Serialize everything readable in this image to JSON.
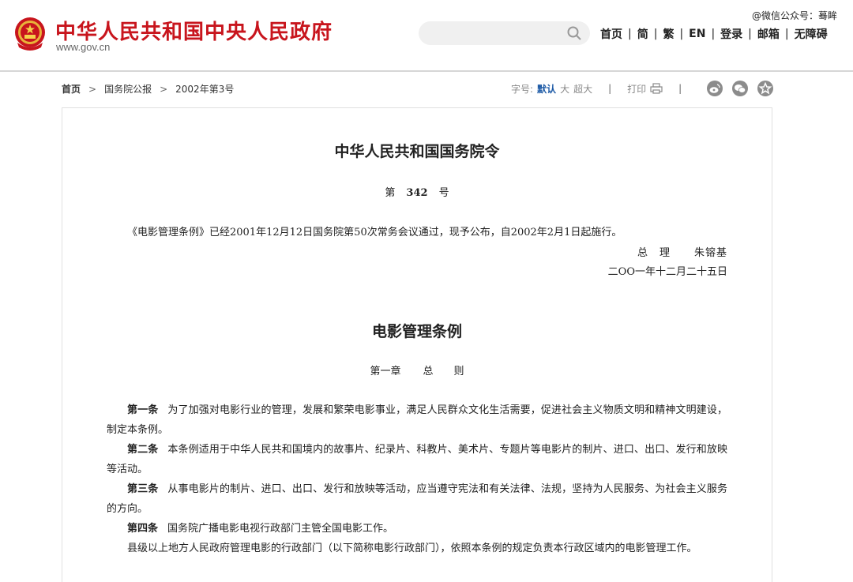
{
  "header": {
    "site_title": "中华人民共和国中央人民政府",
    "site_domain": "www.gov.cn",
    "watermark": "@微信公众号：蓦眸",
    "nav": [
      "首页",
      "简",
      "繁",
      "EN",
      "登录",
      "邮箱",
      "无障碍"
    ]
  },
  "breadcrumb": [
    "首页",
    "国务院公报",
    "2002年第3号"
  ],
  "toolbar": {
    "font_label": "字号:",
    "font_sizes": [
      "默认",
      "大",
      "超大"
    ],
    "print_label": "打印",
    "share_icons": [
      "weibo-icon",
      "wechat-icon",
      "favorite-icon"
    ]
  },
  "article": {
    "order_title": "中华人民共和国国务院令",
    "order_prefix": "第",
    "order_number": "342",
    "order_suffix": "号",
    "decree": "《电影管理条例》已经2001年12月12日国务院第50次常务会议通过，现予公布，自2002年2月1日起施行。",
    "signer_role": "总　理",
    "signer_name": "朱镕基",
    "sign_date": "二OO一年十二月二十五日",
    "reg_title": "电影管理条例",
    "chapter_no": "第一章",
    "chapter_name": "总　　则",
    "clauses": [
      {
        "label": "第一条",
        "text": "为了加强对电影行业的管理，发展和繁荣电影事业，满足人民群众文化生活需要，促进社会主义物质文明和精神文明建设，制定本条例。"
      },
      {
        "label": "第二条",
        "text": "本条例适用于中华人民共和国境内的故事片、纪录片、科教片、美术片、专题片等电影片的制片、进口、出口、发行和放映等活动。"
      },
      {
        "label": "第三条",
        "text": "从事电影片的制片、进口、出口、发行和放映等活动，应当遵守宪法和有关法律、法规，坚持为人民服务、为社会主义服务的方向。"
      },
      {
        "label": "第四条",
        "text": "国务院广播电影电视行政部门主管全国电影工作。"
      },
      {
        "label": "",
        "text": "县级以上地方人民政府管理电影的行政部门（以下简称电影行政部门），依照本条例的规定负责本行政区域内的电影管理工作。"
      }
    ]
  }
}
